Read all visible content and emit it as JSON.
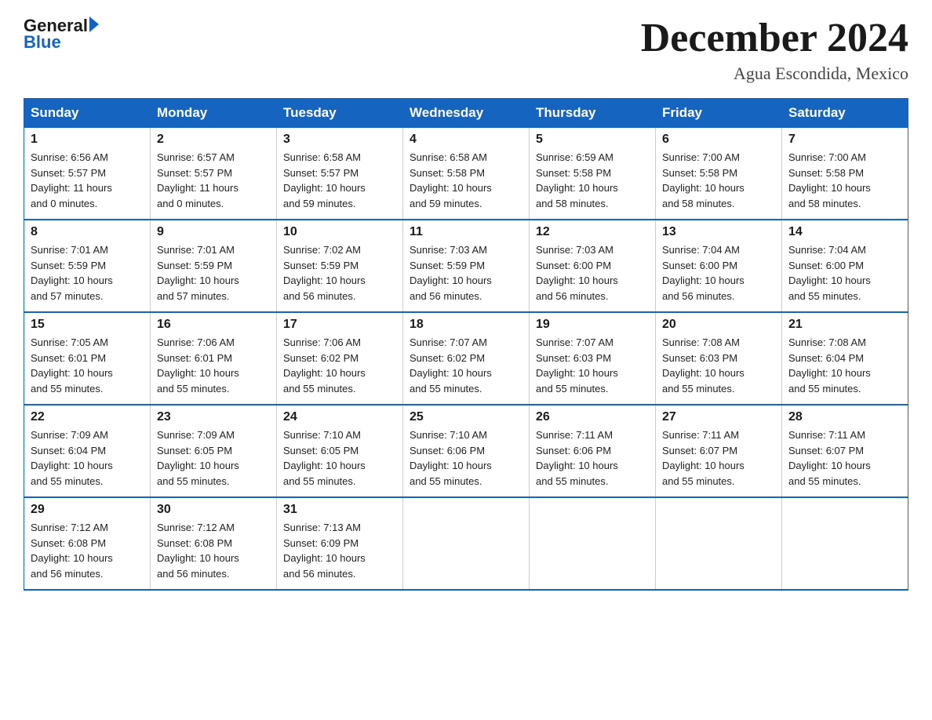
{
  "header": {
    "logo_general": "General",
    "logo_blue": "Blue",
    "month_title": "December 2024",
    "location": "Agua Escondida, Mexico"
  },
  "days_of_week": [
    "Sunday",
    "Monday",
    "Tuesday",
    "Wednesday",
    "Thursday",
    "Friday",
    "Saturday"
  ],
  "weeks": [
    [
      {
        "day": "1",
        "sunrise": "6:56 AM",
        "sunset": "5:57 PM",
        "daylight": "11 hours and 0 minutes."
      },
      {
        "day": "2",
        "sunrise": "6:57 AM",
        "sunset": "5:57 PM",
        "daylight": "11 hours and 0 minutes."
      },
      {
        "day": "3",
        "sunrise": "6:58 AM",
        "sunset": "5:57 PM",
        "daylight": "10 hours and 59 minutes."
      },
      {
        "day": "4",
        "sunrise": "6:58 AM",
        "sunset": "5:58 PM",
        "daylight": "10 hours and 59 minutes."
      },
      {
        "day": "5",
        "sunrise": "6:59 AM",
        "sunset": "5:58 PM",
        "daylight": "10 hours and 58 minutes."
      },
      {
        "day": "6",
        "sunrise": "7:00 AM",
        "sunset": "5:58 PM",
        "daylight": "10 hours and 58 minutes."
      },
      {
        "day": "7",
        "sunrise": "7:00 AM",
        "sunset": "5:58 PM",
        "daylight": "10 hours and 58 minutes."
      }
    ],
    [
      {
        "day": "8",
        "sunrise": "7:01 AM",
        "sunset": "5:59 PM",
        "daylight": "10 hours and 57 minutes."
      },
      {
        "day": "9",
        "sunrise": "7:01 AM",
        "sunset": "5:59 PM",
        "daylight": "10 hours and 57 minutes."
      },
      {
        "day": "10",
        "sunrise": "7:02 AM",
        "sunset": "5:59 PM",
        "daylight": "10 hours and 56 minutes."
      },
      {
        "day": "11",
        "sunrise": "7:03 AM",
        "sunset": "5:59 PM",
        "daylight": "10 hours and 56 minutes."
      },
      {
        "day": "12",
        "sunrise": "7:03 AM",
        "sunset": "6:00 PM",
        "daylight": "10 hours and 56 minutes."
      },
      {
        "day": "13",
        "sunrise": "7:04 AM",
        "sunset": "6:00 PM",
        "daylight": "10 hours and 56 minutes."
      },
      {
        "day": "14",
        "sunrise": "7:04 AM",
        "sunset": "6:00 PM",
        "daylight": "10 hours and 55 minutes."
      }
    ],
    [
      {
        "day": "15",
        "sunrise": "7:05 AM",
        "sunset": "6:01 PM",
        "daylight": "10 hours and 55 minutes."
      },
      {
        "day": "16",
        "sunrise": "7:06 AM",
        "sunset": "6:01 PM",
        "daylight": "10 hours and 55 minutes."
      },
      {
        "day": "17",
        "sunrise": "7:06 AM",
        "sunset": "6:02 PM",
        "daylight": "10 hours and 55 minutes."
      },
      {
        "day": "18",
        "sunrise": "7:07 AM",
        "sunset": "6:02 PM",
        "daylight": "10 hours and 55 minutes."
      },
      {
        "day": "19",
        "sunrise": "7:07 AM",
        "sunset": "6:03 PM",
        "daylight": "10 hours and 55 minutes."
      },
      {
        "day": "20",
        "sunrise": "7:08 AM",
        "sunset": "6:03 PM",
        "daylight": "10 hours and 55 minutes."
      },
      {
        "day": "21",
        "sunrise": "7:08 AM",
        "sunset": "6:04 PM",
        "daylight": "10 hours and 55 minutes."
      }
    ],
    [
      {
        "day": "22",
        "sunrise": "7:09 AM",
        "sunset": "6:04 PM",
        "daylight": "10 hours and 55 minutes."
      },
      {
        "day": "23",
        "sunrise": "7:09 AM",
        "sunset": "6:05 PM",
        "daylight": "10 hours and 55 minutes."
      },
      {
        "day": "24",
        "sunrise": "7:10 AM",
        "sunset": "6:05 PM",
        "daylight": "10 hours and 55 minutes."
      },
      {
        "day": "25",
        "sunrise": "7:10 AM",
        "sunset": "6:06 PM",
        "daylight": "10 hours and 55 minutes."
      },
      {
        "day": "26",
        "sunrise": "7:11 AM",
        "sunset": "6:06 PM",
        "daylight": "10 hours and 55 minutes."
      },
      {
        "day": "27",
        "sunrise": "7:11 AM",
        "sunset": "6:07 PM",
        "daylight": "10 hours and 55 minutes."
      },
      {
        "day": "28",
        "sunrise": "7:11 AM",
        "sunset": "6:07 PM",
        "daylight": "10 hours and 55 minutes."
      }
    ],
    [
      {
        "day": "29",
        "sunrise": "7:12 AM",
        "sunset": "6:08 PM",
        "daylight": "10 hours and 56 minutes."
      },
      {
        "day": "30",
        "sunrise": "7:12 AM",
        "sunset": "6:08 PM",
        "daylight": "10 hours and 56 minutes."
      },
      {
        "day": "31",
        "sunrise": "7:13 AM",
        "sunset": "6:09 PM",
        "daylight": "10 hours and 56 minutes."
      },
      null,
      null,
      null,
      null
    ]
  ],
  "labels": {
    "sunrise": "Sunrise:",
    "sunset": "Sunset:",
    "daylight": "Daylight:"
  }
}
